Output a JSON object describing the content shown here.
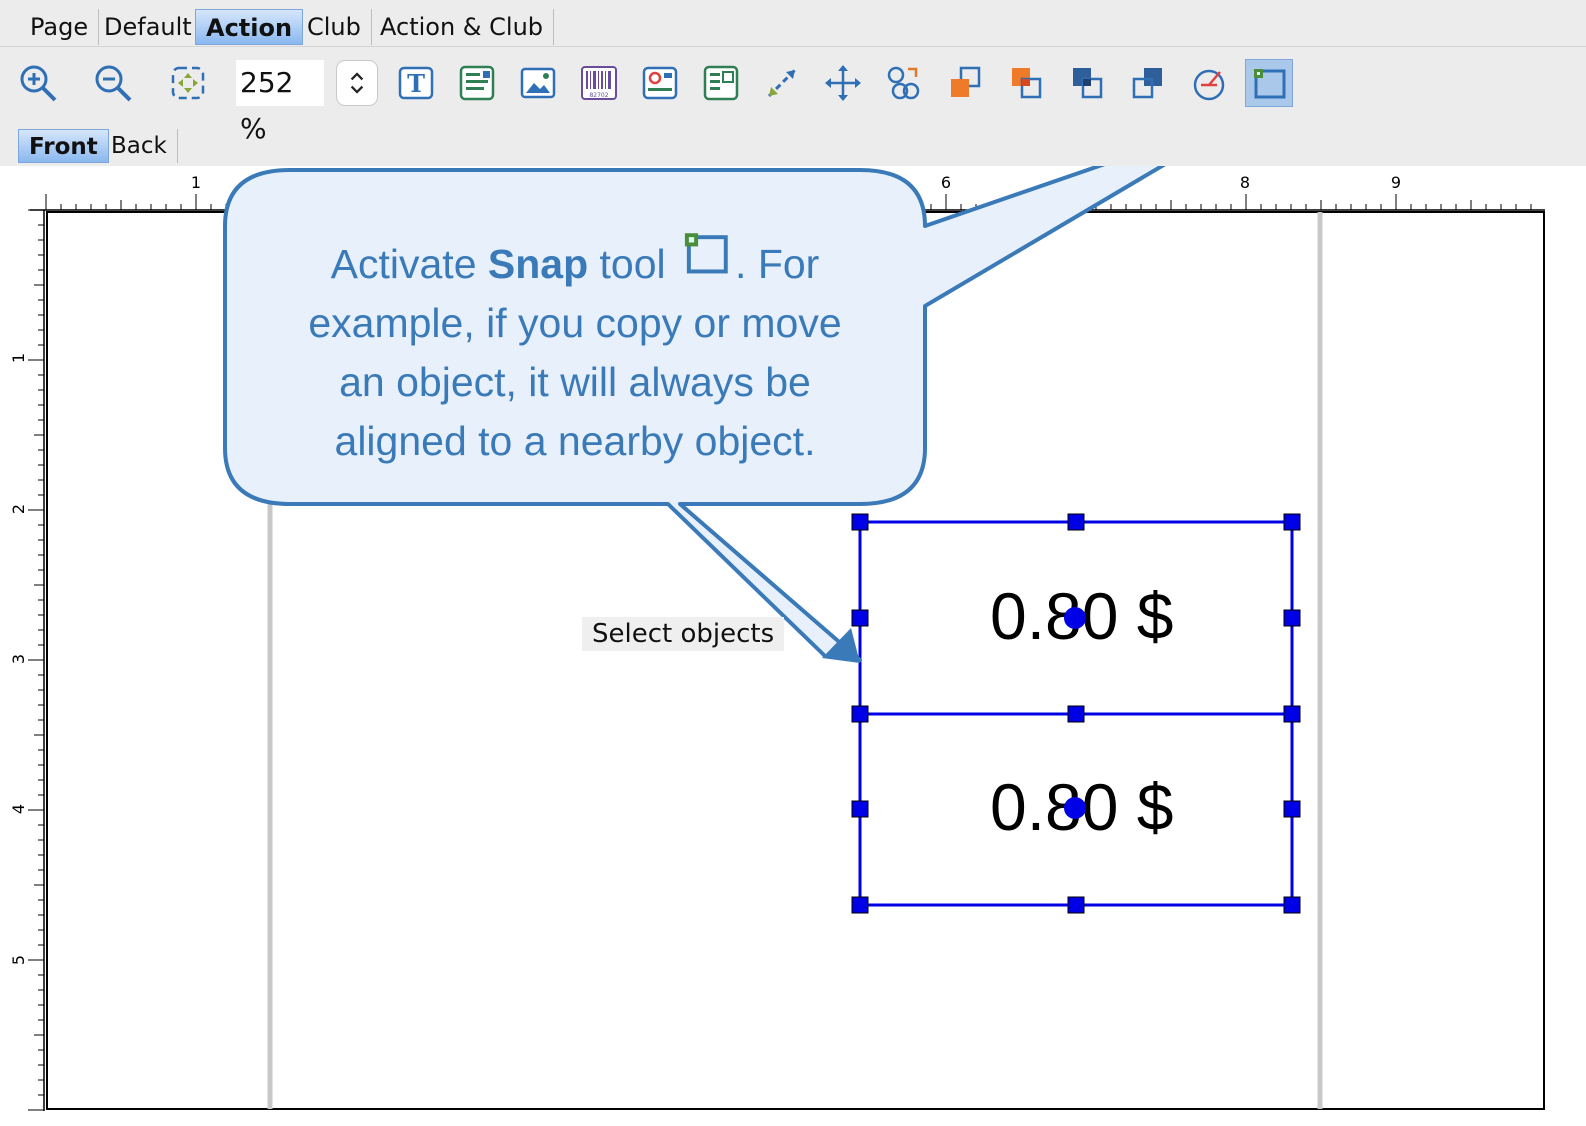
{
  "tabs": [
    {
      "label": "Page",
      "active": false
    },
    {
      "label": "Default",
      "active": false
    },
    {
      "label": "Action",
      "active": true
    },
    {
      "label": "Club",
      "active": false
    },
    {
      "label": "Action & Club",
      "active": false
    }
  ],
  "toolbar": {
    "zoom_value": "252 %",
    "buttons": [
      {
        "name": "zoom-in-icon"
      },
      {
        "name": "zoom-out-icon"
      },
      {
        "name": "fit-page-icon"
      },
      {
        "name": "text-object-icon"
      },
      {
        "name": "paragraph-object-icon"
      },
      {
        "name": "image-object-icon"
      },
      {
        "name": "barcode-object-icon"
      },
      {
        "name": "image-field-icon"
      },
      {
        "name": "list-object-icon"
      },
      {
        "name": "line-tool-icon"
      },
      {
        "name": "move-tool-icon"
      },
      {
        "name": "group-icon"
      },
      {
        "name": "bring-to-front-icon"
      },
      {
        "name": "send-forward-icon"
      },
      {
        "name": "send-backward-icon"
      },
      {
        "name": "send-to-back-icon"
      },
      {
        "name": "rotate-icon"
      },
      {
        "name": "snap-tool-icon",
        "selected": true
      }
    ],
    "barcode_digits": "82702"
  },
  "side_tabs": [
    {
      "label": "Front",
      "active": true
    },
    {
      "label": "Back",
      "active": false
    }
  ],
  "ruler": {
    "top_labels": [
      "1",
      "6",
      "8",
      "9"
    ],
    "left_labels": [
      "1",
      "2",
      "3",
      "4",
      "5"
    ]
  },
  "canvas": {
    "select_label": "Select objects",
    "objects": [
      {
        "text": "0.80 $"
      },
      {
        "text": "0.80 $"
      }
    ]
  },
  "callout": {
    "line1_pre": "Activate ",
    "line1_bold": "Snap",
    "line1_post": " tool",
    "line1_tail": ". For",
    "line2": "example, if you copy or move",
    "line3": "an object, it will always be",
    "line4": "aligned to a nearby object."
  },
  "colors": {
    "accent": "#3a7ab8",
    "selection": "#0000e6",
    "callout_fill": "#e8f1fb",
    "callout_stroke": "#3a7ab8"
  }
}
